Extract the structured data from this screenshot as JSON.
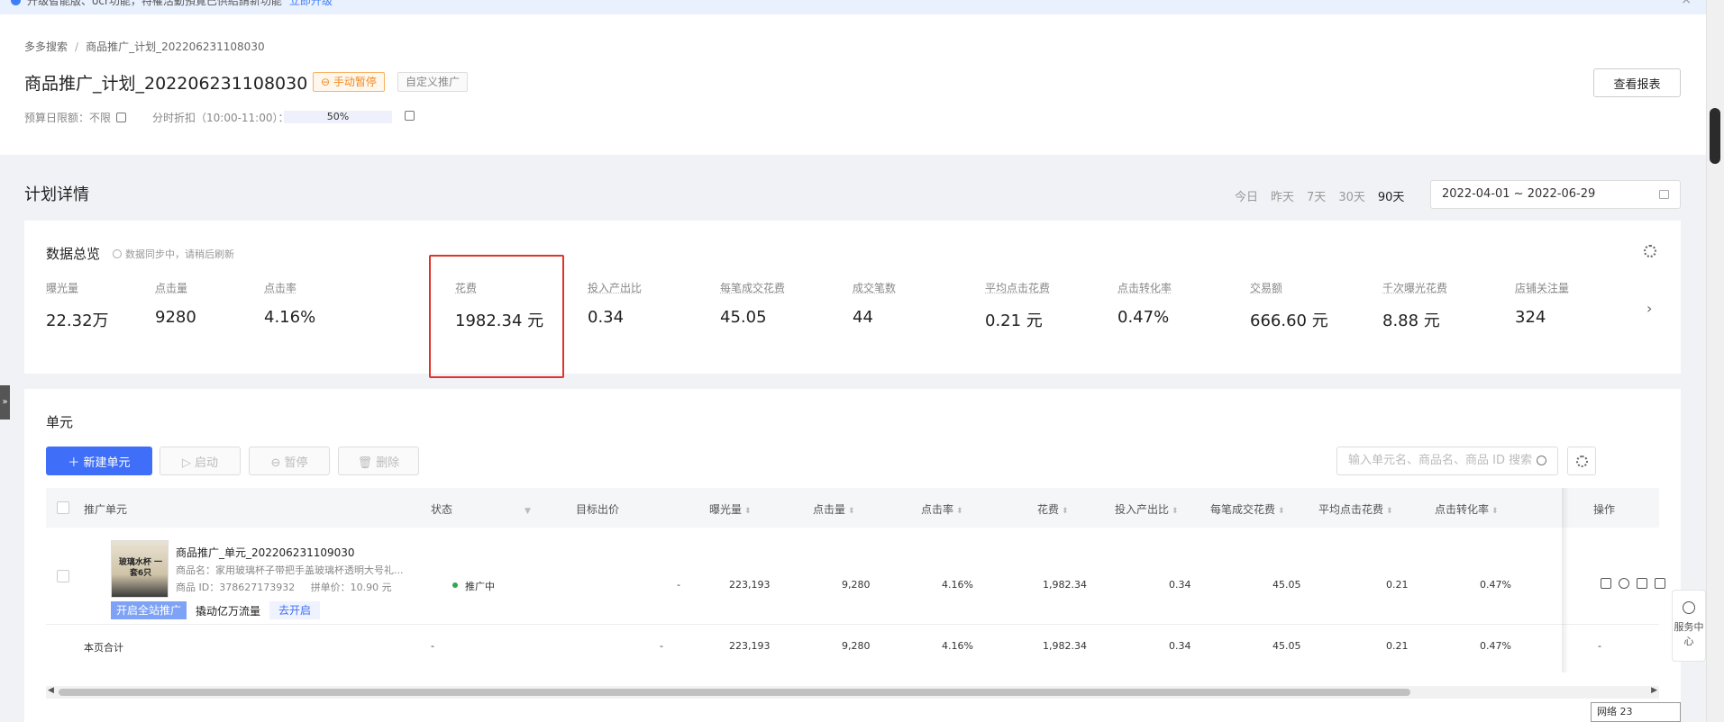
{
  "banner": {
    "text": "升级智能版、ocr功能，特權活動預覽已供給請新功能",
    "link": "立即升级",
    "close": "×"
  },
  "breadcrumb": {
    "root": "多多搜索",
    "sep": "/",
    "current": "商品推广_计划_202206231108030"
  },
  "plan": {
    "title": "商品推广_计划_202206231108030",
    "status_tag": "⊖ 手动暂停",
    "type_tag": "自定义推广",
    "budget": "预算日限额：不限",
    "discount_label": "分时折扣（10:00-11:00）：",
    "discount_value": "50%",
    "report_button": "查看报表"
  },
  "detail": {
    "title": "计划详情",
    "ranges": [
      "今日",
      "昨天",
      "7天",
      "30天",
      "90天"
    ],
    "active_range": "90天",
    "date_range": "2022-04-01 ~ 2022-06-29"
  },
  "overview": {
    "title": "数据总览",
    "note": "数据同步中，请稍后刷新",
    "next": "›",
    "metrics": [
      {
        "label": "曝光量",
        "value": "22.32万"
      },
      {
        "label": "点击量",
        "value": "9280"
      },
      {
        "label": "点击率",
        "value": "4.16%"
      },
      {
        "label": "花费",
        "value": "1982.34 元"
      },
      {
        "label": "投入产出比",
        "value": "0.34"
      },
      {
        "label": "每笔成交花费",
        "value": "45.05"
      },
      {
        "label": "成交笔数",
        "value": "44"
      },
      {
        "label": "平均点击花费",
        "value": "0.21 元"
      },
      {
        "label": "点击转化率",
        "value": "0.47%"
      },
      {
        "label": "交易额",
        "value": "666.60 元"
      },
      {
        "label": "千次曝光花费",
        "value": "8.88 元"
      },
      {
        "label": "店铺关注量",
        "value": "324"
      }
    ]
  },
  "side_tab": "»",
  "unit": {
    "title": "单元",
    "buttons": {
      "new": "＋ 新建单元",
      "start": "▷ 启动",
      "pause": "⊖ 暂停",
      "delete": "🗑 删除"
    },
    "search_placeholder": "输入单元名、商品名、商品 ID 搜索",
    "columns": [
      "推广单元",
      "状态",
      "目标出价",
      "曝光量",
      "点击量",
      "点击率",
      "花费",
      "投入产出比",
      "每笔成交花费",
      "平均点击花费",
      "点击转化率",
      "操作"
    ],
    "row": {
      "thumb_text": "玻璃水杯 一套6只",
      "unit_name": "商品推广_单元_202206231109030",
      "product_name": "商品名：家用玻璃杯子带把手盖玻璃杯透明大号礼...",
      "product_id": "商品 ID：378627173932",
      "group_price": "拼单价：10.90 元",
      "promo_tag": "开启全站推广",
      "promo_text": "撬动亿万流量",
      "promo_link": "去开启",
      "status": "推广中",
      "bid": "-",
      "impressions": "223,193",
      "clicks": "9,280",
      "ctr": "4.16%",
      "cost": "1,982.34",
      "roi": "0.34",
      "cost_per_order": "45.05",
      "cpc": "0.21",
      "cvr": "0.47%"
    },
    "summary": {
      "label": "本页合计",
      "status": "-",
      "bid": "-",
      "impressions": "223,193",
      "clicks": "9,280",
      "ctr": "4.16%",
      "cost": "1,982.34",
      "roi": "0.34",
      "cost_per_order": "45.05",
      "cpc": "0.21",
      "cvr": "0.47%",
      "ops": "-"
    }
  },
  "service": {
    "label": "服务中心"
  },
  "network": "网络 23"
}
